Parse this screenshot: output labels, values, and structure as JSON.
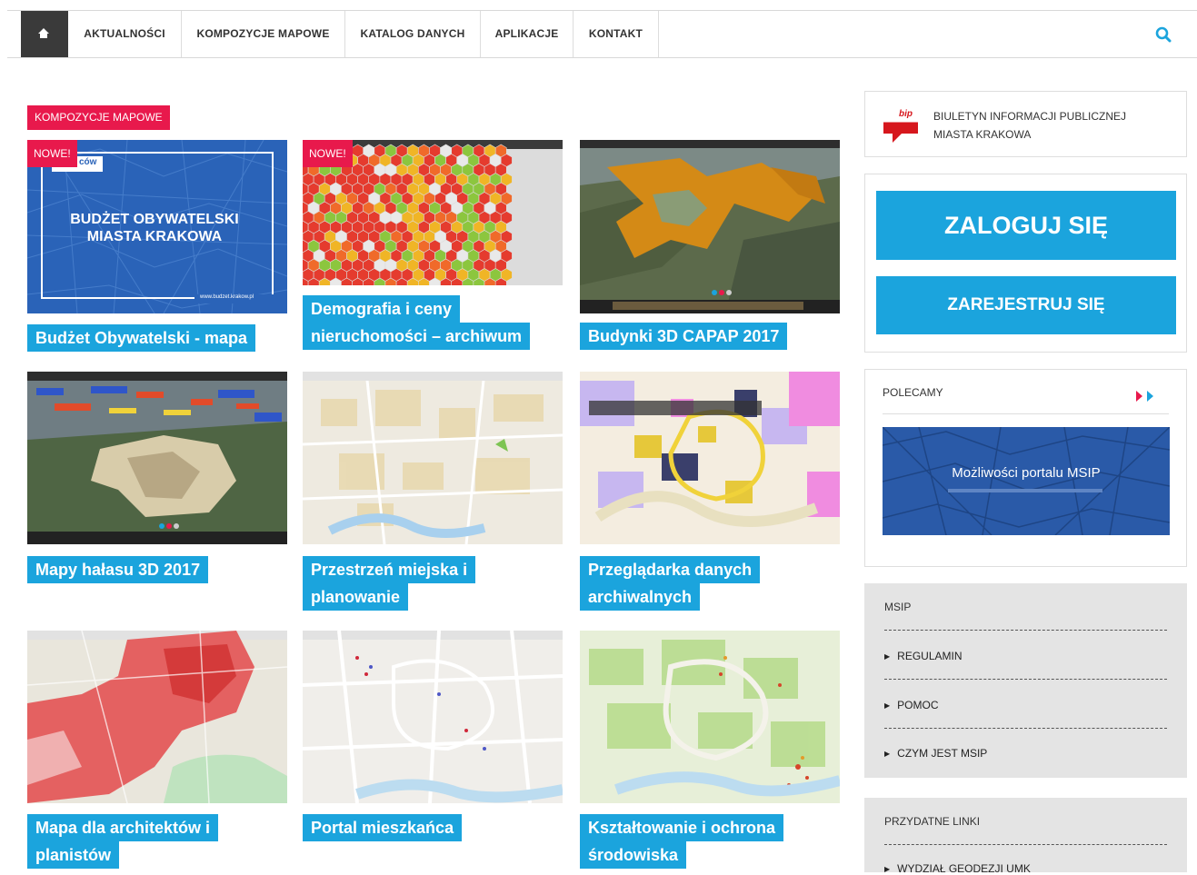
{
  "nav": {
    "items": [
      "AKTUALNOŚCI",
      "KOMPOZYCJE MAPOWE",
      "KATALOG DANYCH",
      "APLIKACJE",
      "KONTAKT"
    ]
  },
  "section": {
    "label": "KOMPOZYCJE MAPOWE"
  },
  "badge_new": "NOWE!",
  "cards": [
    {
      "title_lines": [
        "Budżet Obywatelski - mapa"
      ],
      "is_new": true,
      "thumb_title": "BUDŻET OBYWATELSKI MIASTA KRAKOWA",
      "thumb_logo": "ców",
      "thumb_url": "www.budzet.krakow.pl"
    },
    {
      "title_lines": [
        "Demografia i ceny",
        "nieruchomości – archiwum"
      ],
      "is_new": true
    },
    {
      "title_lines": [
        "Budynki 3D CAPAP 2017"
      ],
      "is_new": false
    },
    {
      "title_lines": [
        "Mapy hałasu 3D 2017"
      ],
      "is_new": false
    },
    {
      "title_lines": [
        "Przestrzeń miejska i",
        "planowanie"
      ],
      "is_new": false
    },
    {
      "title_lines": [
        "Przeglądarka danych",
        "archiwalnych"
      ],
      "is_new": false
    },
    {
      "title_lines": [
        "Mapa dla architektów i",
        "planistów"
      ],
      "is_new": false
    },
    {
      "title_lines": [
        "Portal mieszkańca"
      ],
      "is_new": false
    },
    {
      "title_lines": [
        "Kształtowanie i ochrona",
        "środowiska"
      ],
      "is_new": false
    }
  ],
  "sidebar": {
    "bip_logo": "bip",
    "bip_line1": "BIULETYN INFORMACJI PUBLICZNEJ",
    "bip_line2": "MIASTA KRAKOWA",
    "login_label": "ZALOGUJ SIĘ",
    "register_label": "ZAREJESTRUJ SIĘ",
    "recommended_label": "POLECAMY",
    "banner_text": "Możliwości portalu MSIP",
    "msip_title": "MSIP",
    "msip_links": [
      "REGULAMIN",
      "POMOC",
      "CZYM JEST MSIP"
    ],
    "useful_title": "PRZYDATNE LINKI",
    "useful_links": [
      "WYDZIAŁ GEODEZJI UMK"
    ]
  },
  "colors": {
    "accent_blue": "#1ba4dd",
    "accent_red": "#e8194c",
    "dark": "#3a3a3a"
  }
}
